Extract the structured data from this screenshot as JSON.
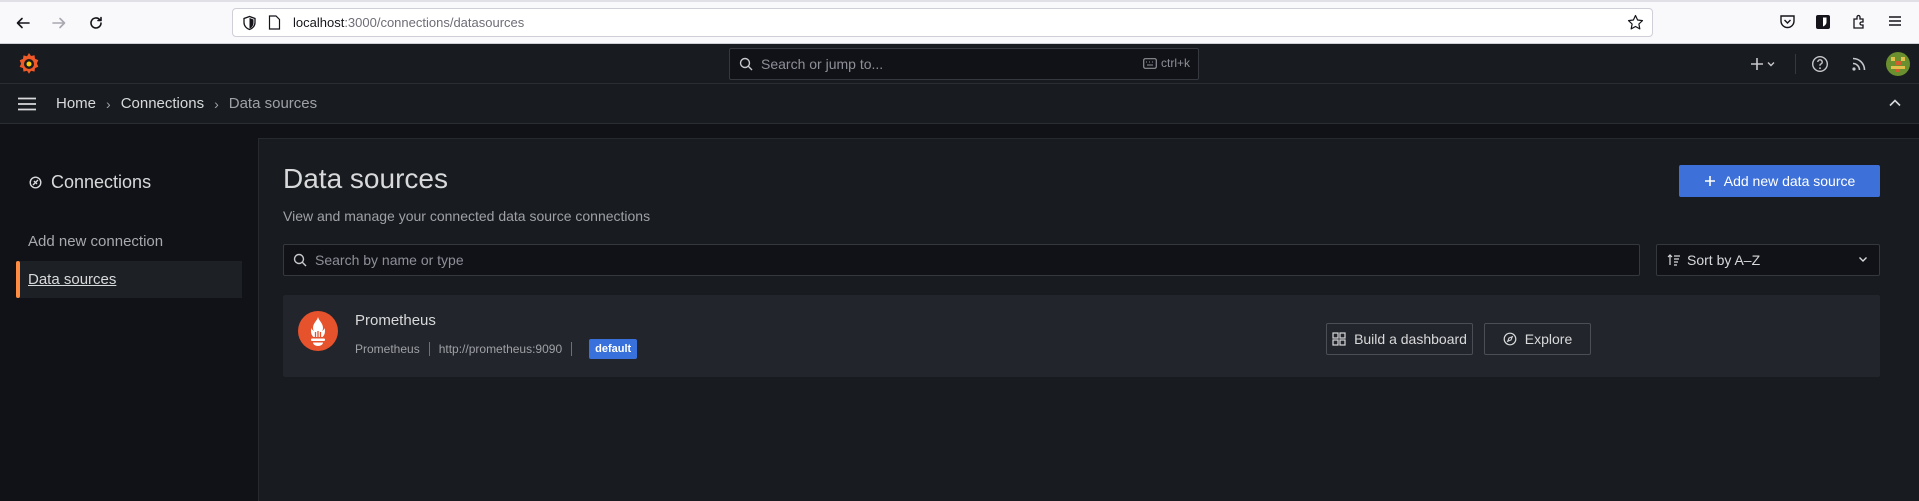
{
  "browser": {
    "url_host": "localhost",
    "url_path": ":3000/connections/datasources"
  },
  "topbar": {
    "search_placeholder": "Search or jump to...",
    "shortcut": "ctrl+k"
  },
  "breadcrumb": {
    "items": [
      "Home",
      "Connections",
      "Data sources"
    ]
  },
  "sidebar": {
    "title": "Connections",
    "items": [
      {
        "label": "Add new connection"
      },
      {
        "label": "Data sources"
      }
    ]
  },
  "main": {
    "title": "Data sources",
    "subtitle": "View and manage your connected data source connections",
    "add_button": "Add new data source",
    "search_placeholder": "Search by name or type",
    "sort_label": "Sort by A–Z",
    "datasources": [
      {
        "name": "Prometheus",
        "type": "Prometheus",
        "url": "http://prometheus:9090",
        "badge": "default",
        "build_button": "Build a dashboard",
        "explore_button": "Explore"
      }
    ]
  },
  "colors": {
    "accent": "#3d71d9",
    "brand_orange": "#f05a28",
    "active_indicator": "#ff8c43"
  }
}
